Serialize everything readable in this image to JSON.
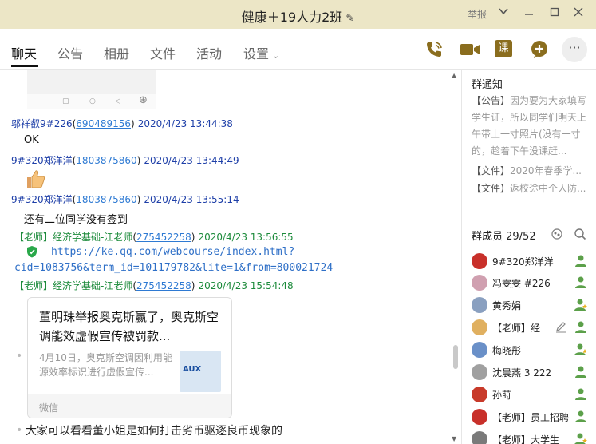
{
  "window": {
    "title": "健康＋19人力2班",
    "report_label": "举报"
  },
  "tabs": [
    {
      "label": "聊天"
    },
    {
      "label": "公告"
    },
    {
      "label": "相册"
    },
    {
      "label": "文件"
    },
    {
      "label": "活动"
    },
    {
      "label": "设置"
    }
  ],
  "toolbar": {
    "lesson_label": "课",
    "more_label": "···"
  },
  "messages": [
    {
      "sender": "邬祥叡9#226",
      "qq": "690489156",
      "time": "2020/4/23 13:44:38",
      "text": "OK"
    },
    {
      "sender": "9#320郑洋洋",
      "qq": "1803875860",
      "time": "2020/4/23 13:44:49",
      "emoji": "👍"
    },
    {
      "sender": "9#320郑洋洋",
      "qq": "1803875860",
      "time": "2020/4/23 13:55:14",
      "text": "还有二位同学没有签到"
    },
    {
      "sender": "【老师】经济学基础-江老师",
      "qq": "275452258",
      "time": "2020/4/23 13:56:55",
      "link_line1": "https://ke.qq.com/webcourse/index.html?",
      "link_line2": "cid=1083756&term_id=101179782&lite=1&from=800021724"
    },
    {
      "sender": "【老师】经济学基础-江老师",
      "qq": "275452258",
      "time": "2020/4/23 15:54:48"
    }
  ],
  "card": {
    "title": "董明珠举报奥克斯赢了，奥克斯空调能效虚假宣传被罚款...",
    "desc": "4月10日，奥克斯空调因利用能源效率标识进行虚假宣传...",
    "thumb_text": "AUX",
    "source": "微信"
  },
  "last_message": "大家可以看看董小姐是如何打击劣币驱逐良币现象的",
  "side": {
    "notice_header": "群通知",
    "notice_items": [
      {
        "tag": "【公告】",
        "text": "因为要为大家填写学生证，所以同学们明天上午带上一寸照片(没有一寸的，趁着下午没课赶..."
      },
      {
        "tag": "【文件】",
        "text": "2020年春季学..."
      },
      {
        "tag": "【文件】",
        "text": "返校途中个人防..."
      }
    ],
    "members_header": "群成员 29/52",
    "members": [
      {
        "name": "9#320郑洋洋",
        "color": "#c8302a"
      },
      {
        "name": "冯雯雯 #226",
        "color": "#d0a0b0"
      },
      {
        "name": "黄秀娟",
        "color": "#8aa0c0"
      },
      {
        "name": "【老师】经",
        "color": "#e0b060"
      },
      {
        "name": "梅晓彤",
        "color": "#6a90c8"
      },
      {
        "name": "沈晨燕  3  222",
        "color": "#a0a0a0"
      },
      {
        "name": "孙莳",
        "color": "#c83a2a"
      },
      {
        "name": "【老师】员工招聘",
        "color": "#c8302a"
      },
      {
        "name": "【老师】大学生",
        "color": "#7a7a7a"
      }
    ]
  },
  "colors": {
    "titlebar": "#ECE6C6",
    "accent_gold": "#8a6d1e",
    "sender_blue": "#1e3fa8",
    "teacher_green": "#1b8a3a",
    "link_blue": "#2e7ad3"
  }
}
